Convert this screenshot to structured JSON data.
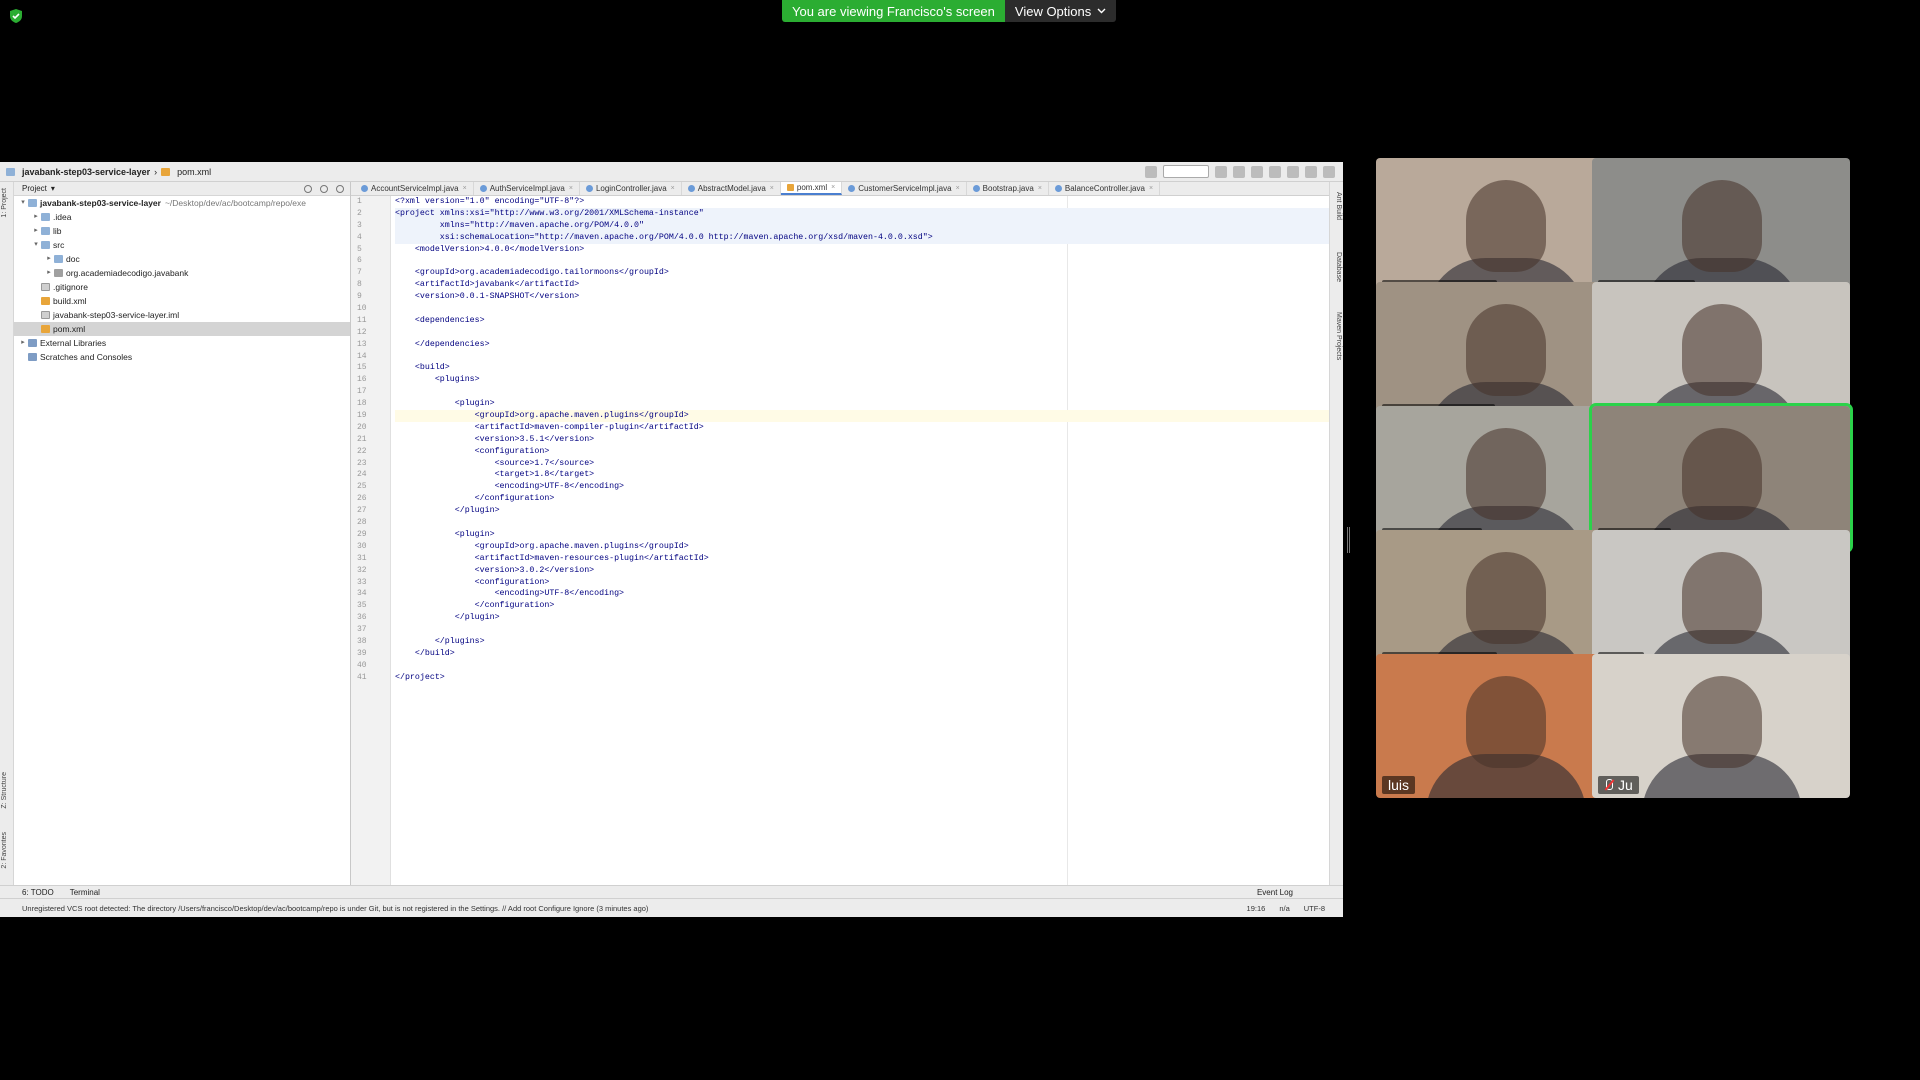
{
  "zoom": {
    "banner": "You are viewing Francisco's screen",
    "view_options": "View Options",
    "accent": "#2bad32"
  },
  "ide": {
    "breadcrumb": {
      "project": "javabank-step03-service-layer",
      "file": "pom.xml"
    },
    "left_tabs": [
      "1: Project",
      "Z: Structure",
      "2: Favorites"
    ],
    "right_tabs": [
      "Ant Build",
      "Database",
      "Maven Projects"
    ],
    "project_panel": {
      "title": "Project",
      "tree": [
        {
          "label": "javabank-step03-service-layer",
          "hint": "~/Desktop/dev/ac/bootcamp/repo/exe",
          "indent": 0,
          "icon": "folder",
          "arrow": "▾",
          "bold": true
        },
        {
          "label": ".idea",
          "indent": 1,
          "icon": "folder",
          "arrow": "▸"
        },
        {
          "label": "lib",
          "indent": 1,
          "icon": "folder",
          "arrow": "▸"
        },
        {
          "label": "src",
          "indent": 1,
          "icon": "folder",
          "arrow": "▾"
        },
        {
          "label": "doc",
          "indent": 2,
          "icon": "folder",
          "arrow": "▸"
        },
        {
          "label": "org.academiadecodigo.javabank",
          "indent": 2,
          "icon": "pkg",
          "arrow": "▸"
        },
        {
          "label": ".gitignore",
          "indent": 1,
          "icon": "file",
          "arrow": ""
        },
        {
          "label": "build.xml",
          "indent": 1,
          "icon": "xml",
          "arrow": ""
        },
        {
          "label": "javabank-step03-service-layer.iml",
          "indent": 1,
          "icon": "file",
          "arrow": ""
        },
        {
          "label": "pom.xml",
          "indent": 1,
          "icon": "xml",
          "arrow": "",
          "selected": true
        },
        {
          "label": "External Libraries",
          "indent": 0,
          "icon": "lib",
          "arrow": "▸"
        },
        {
          "label": "Scratches and Consoles",
          "indent": 0,
          "icon": "lib",
          "arrow": ""
        }
      ]
    },
    "tabs": [
      {
        "label": "AccountServiceImpl.java",
        "type": "java"
      },
      {
        "label": "AuthServiceImpl.java",
        "type": "java"
      },
      {
        "label": "LoginController.java",
        "type": "java"
      },
      {
        "label": "AbstractModel.java",
        "type": "java"
      },
      {
        "label": "pom.xml",
        "type": "xml",
        "active": true
      },
      {
        "label": "CustomerServiceImpl.java",
        "type": "java"
      },
      {
        "label": "Bootstrap.java",
        "type": "java"
      },
      {
        "label": "BalanceController.java",
        "type": "java"
      }
    ],
    "code_lines": [
      "<?xml version=\"1.0\" encoding=\"UTF-8\"?>",
      "<project xmlns:xsi=\"http://www.w3.org/2001/XMLSchema-instance\"",
      "         xmlns=\"http://maven.apache.org/POM/4.0.0\"",
      "         xsi:schemaLocation=\"http://maven.apache.org/POM/4.0.0 http://maven.apache.org/xsd/maven-4.0.0.xsd\">",
      "    <modelVersion>4.0.0</modelVersion>",
      "",
      "    <groupId>org.academiadecodigo.tailormoons</groupId>",
      "    <artifactId>javabank</artifactId>",
      "    <version>0.0.1-SNAPSHOT</version>",
      "",
      "    <dependencies>",
      "",
      "    </dependencies>",
      "",
      "    <build>",
      "        <plugins>",
      "",
      "            <plugin>",
      "                <groupId>org.apache.maven.plugins</groupId>",
      "                <artifactId>maven-compiler-plugin</artifactId>",
      "                <version>3.5.1</version>",
      "                <configuration>",
      "                    <source>1.7</source>",
      "                    <target>1.8</target>",
      "                    <encoding>UTF-8</encoding>",
      "                </configuration>",
      "            </plugin>",
      "",
      "            <plugin>",
      "                <groupId>org.apache.maven.plugins</groupId>",
      "                <artifactId>maven-resources-plugin</artifactId>",
      "                <version>3.0.2</version>",
      "                <configuration>",
      "                    <encoding>UTF-8</encoding>",
      "                </configuration>",
      "            </plugin>",
      "",
      "        </plugins>",
      "    </build>",
      "",
      "</project>"
    ],
    "current_line": 19,
    "bottom_tabs": {
      "todo": "6: TODO",
      "terminal": "Terminal",
      "event_log": "Event Log"
    },
    "status": {
      "message": "Unregistered VCS root detected: The directory /Users/francisco/Desktop/dev/ac/bootcamp/repo is under Git, but is not registered in the Settings. // Add root  Configure  Ignore (3 minutes ago)",
      "position": "19:16",
      "na": "n/a",
      "encoding": "UTF-8"
    }
  },
  "participants": [
    {
      "name": "Giselle Quarto",
      "muted": true,
      "bg": "#b9a99a"
    },
    {
      "name": "Marco Dias",
      "muted": true,
      "bg": "#8d8d8a"
    },
    {
      "name": "Pedro Gaspar",
      "muted": true,
      "bg": "#9f9283"
    },
    {
      "name": "Carlos Nunes",
      "muted": true,
      "bg": "#c8c4be"
    },
    {
      "name": "luis almeida",
      "muted": true,
      "bg": "#a7a59d"
    },
    {
      "name": "Francisco",
      "muted": false,
      "active": true,
      "bg": "#8e8479"
    },
    {
      "name": "Cássio Freitas",
      "muted": true,
      "bg": "#a89a86"
    },
    {
      "name": "Sid",
      "muted": true,
      "bg": "#c9c7c3"
    },
    {
      "name": "luis",
      "muted": false,
      "bg": "#c97a4d"
    },
    {
      "name": "Ju",
      "muted": true,
      "bg": "#d7d2ca"
    }
  ]
}
